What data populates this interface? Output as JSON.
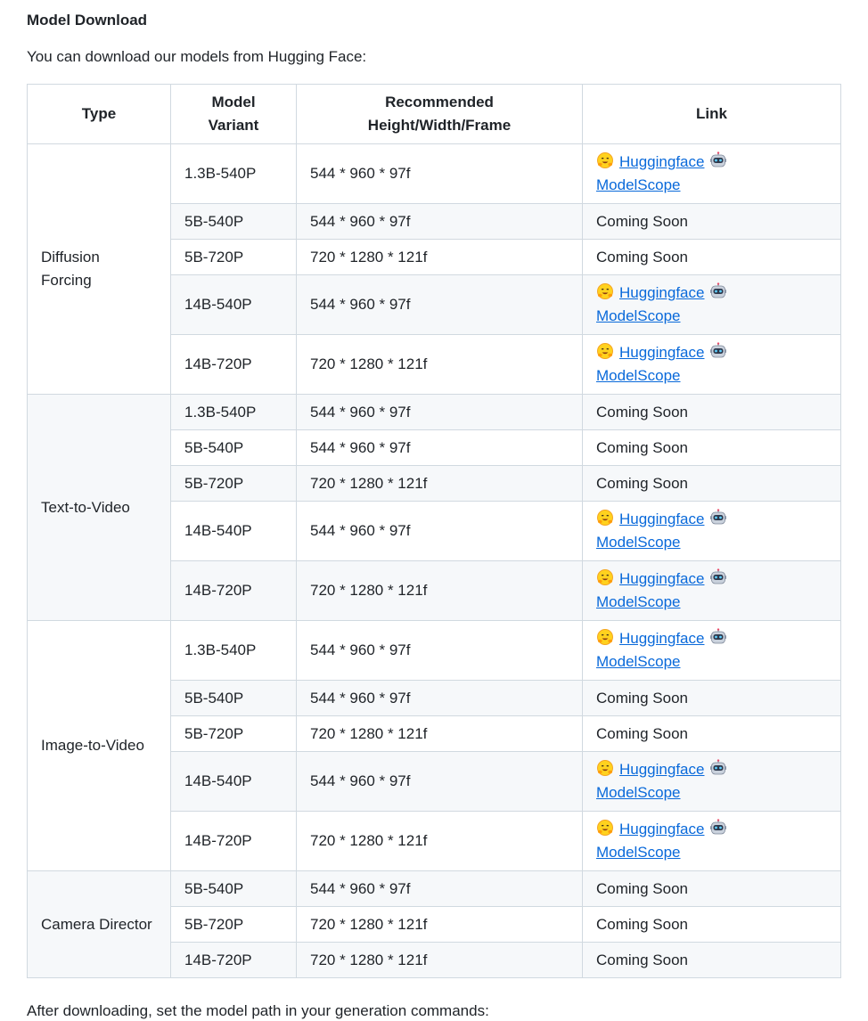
{
  "heading": "Model Download",
  "intro": "You can download our models from Hugging Face:",
  "outro": "After downloading, set the model path in your generation commands:",
  "table": {
    "headers": {
      "type": "Type",
      "variant_line1": "Model",
      "variant_line2": "Variant",
      "res_line1": "Recommended",
      "res_line2": "Height/Width/Frame",
      "link": "Link"
    },
    "links": {
      "hf": "Huggingface",
      "ms": "ModelScope"
    },
    "coming_soon": "Coming Soon",
    "groups": [
      {
        "type_line1": "Diffusion",
        "type_line2": "Forcing",
        "rows": [
          {
            "variant": "1.3B-540P",
            "res": "544 * 960 * 97f",
            "link": "Huggingface ModelScope"
          },
          {
            "variant": "5B-540P",
            "res": "544 * 960 * 97f",
            "link": "Coming Soon"
          },
          {
            "variant": "5B-720P",
            "res": "720 * 1280 * 121f",
            "link": "Coming Soon"
          },
          {
            "variant": "14B-540P",
            "res": "544 * 960 * 97f",
            "link": "Huggingface ModelScope"
          },
          {
            "variant": "14B-720P",
            "res": "720 * 1280 * 121f",
            "link": "Huggingface ModelScope"
          }
        ]
      },
      {
        "type_line1": "Text-to-Video",
        "type_line2": "",
        "rows": [
          {
            "variant": "1.3B-540P",
            "res": "544 * 960 * 97f",
            "link": "Coming Soon"
          },
          {
            "variant": "5B-540P",
            "res": "544 * 960 * 97f",
            "link": "Coming Soon"
          },
          {
            "variant": "5B-720P",
            "res": "720 * 1280 * 121f",
            "link": "Coming Soon"
          },
          {
            "variant": "14B-540P",
            "res": "544 * 960 * 97f",
            "link": "Huggingface ModelScope"
          },
          {
            "variant": "14B-720P",
            "res": "720 * 1280 * 121f",
            "link": "Huggingface ModelScope"
          }
        ]
      },
      {
        "type_line1": "Image-to-Video",
        "type_line2": "",
        "rows": [
          {
            "variant": "1.3B-540P",
            "res": "544 * 960 * 97f",
            "link": "Huggingface ModelScope"
          },
          {
            "variant": "5B-540P",
            "res": "544 * 960 * 97f",
            "link": "Coming Soon"
          },
          {
            "variant": "5B-720P",
            "res": "720 * 1280 * 121f",
            "link": "Coming Soon"
          },
          {
            "variant": "14B-540P",
            "res": "544 * 960 * 97f",
            "link": "Huggingface ModelScope"
          },
          {
            "variant": "14B-720P",
            "res": "720 * 1280 * 121f",
            "link": "Huggingface ModelScope"
          }
        ]
      },
      {
        "type_line1": "Camera Director",
        "type_line2": "",
        "rows": [
          {
            "variant": "5B-540P",
            "res": "544 * 960 * 97f",
            "link": "Coming Soon"
          },
          {
            "variant": "5B-720P",
            "res": "720 * 1280 * 121f",
            "link": "Coming Soon"
          },
          {
            "variant": "14B-720P",
            "res": "720 * 1280 * 121f",
            "link": "Coming Soon"
          }
        ]
      }
    ]
  }
}
